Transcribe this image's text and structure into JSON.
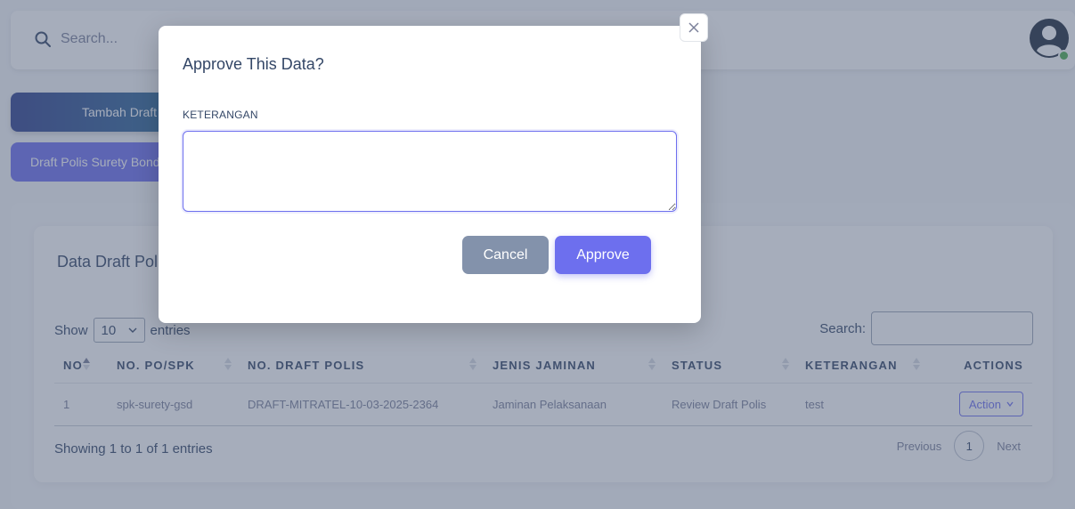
{
  "topbar": {
    "search_placeholder": "Search..."
  },
  "buttons": {
    "tambah_label": "Tambah Draft",
    "draft_tab_label": "Draft Polis Surety Bond"
  },
  "card": {
    "title": "Data Draft Polis"
  },
  "datatable": {
    "show_label": "Show",
    "entries_label": "entries",
    "length_value": "10",
    "search_label": "Search:",
    "columns": [
      "NO",
      "NO. PO/SPK",
      "NO. DRAFT POLIS",
      "JENIS JAMINAN",
      "STATUS",
      "KETERANGAN",
      "ACTIONS"
    ],
    "rows": [
      {
        "no": "1",
        "po_spk": "spk-surety-gsd",
        "draft_polis": "DRAFT-MITRATEL-10-03-2025-2364",
        "jenis": "Jaminan Pelaksanaan",
        "status": "Review Draft Polis",
        "keterangan": "test",
        "action": "Action"
      }
    ],
    "showing_text": "Showing 1 to 1 of 1 entries",
    "previous_label": "Previous",
    "page_number": "1",
    "next_label": "Next"
  },
  "modal": {
    "title": "Approve This Data?",
    "field_label": "KETERANGAN",
    "field_value": "",
    "cancel_label": "Cancel",
    "approve_label": "Approve"
  },
  "colors": {
    "primary": "#6d6fee",
    "secondary": "#8392ab",
    "text": "#344767",
    "status_online": "#4caf50"
  }
}
